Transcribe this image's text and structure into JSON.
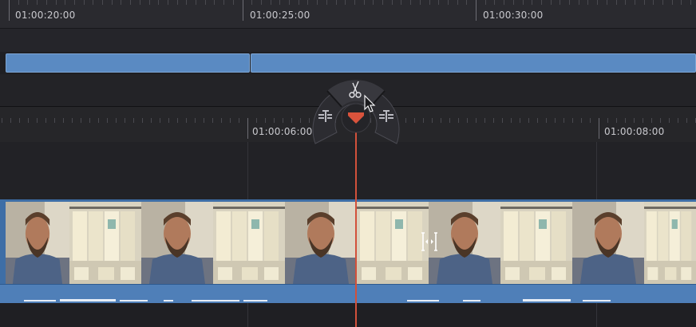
{
  "upper_ruler": {
    "timecodes": [
      "01:00:20:00",
      "01:00:25:00",
      "01:00:30:00"
    ]
  },
  "lower_ruler": {
    "timecodes": [
      "01:00:06:00",
      "01:00:08:00"
    ]
  },
  "edit_menu": {
    "center_icon": "scissors-icon",
    "left_icon": "trim-left-icon",
    "right_icon": "trim-right-icon"
  },
  "icons": [
    "scissors-icon",
    "trim-left-icon",
    "trim-right-icon",
    "pointer-cursor-icon",
    "trim-cursor-icon",
    "playhead-marker-icon"
  ],
  "colors": {
    "clip_blue": "#5a8ac2",
    "playhead": "#d2513b",
    "background": "#1e1e22"
  }
}
